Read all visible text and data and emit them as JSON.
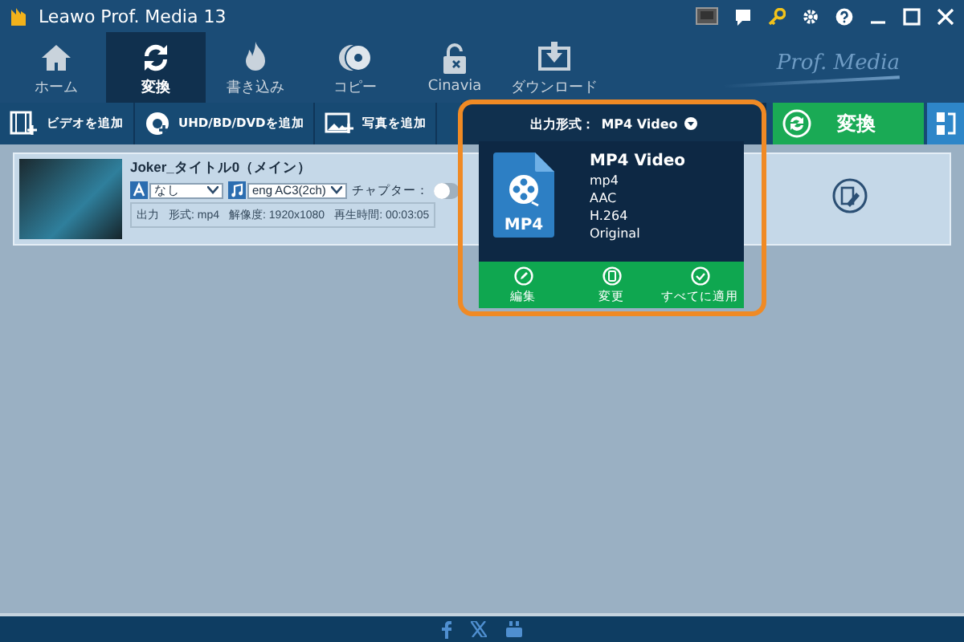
{
  "window": {
    "title": "Leawo Prof. Media 13"
  },
  "nav_tabs": [
    {
      "label": "ホーム",
      "selected": false
    },
    {
      "label": "変換",
      "selected": true
    },
    {
      "label": "書き込み",
      "selected": false
    },
    {
      "label": "コピー",
      "selected": false
    },
    {
      "label": "Cinavia",
      "selected": false
    },
    {
      "label": "ダウンロード",
      "selected": false
    }
  ],
  "brand": "Prof. Media",
  "toolbar": {
    "add_buttons": [
      "ビデオを追加",
      "UHD/BD/DVDを追加",
      "写真を追加"
    ],
    "output_format": {
      "label": "出力形式：",
      "value": "MP4 Video"
    },
    "convert": "変換"
  },
  "video": {
    "title": "Joker_タイトル0（メイン）",
    "subtitle": "なし",
    "audio": "eng AC3(2ch)",
    "chapter_label": "チャプター：",
    "chapter_on": false,
    "output_label": "出力",
    "details": [
      {
        "label": "形式:",
        "value": "mp4"
      },
      {
        "label": "解像度:",
        "value": "1920x1080"
      },
      {
        "label": "再生時間:",
        "value": "00:03:05"
      }
    ]
  },
  "format_popup": {
    "name": "MP4 Video",
    "badge": "MP4",
    "specs": [
      "mp4",
      "AAC",
      "H.264",
      "Original"
    ],
    "actions": [
      {
        "kind": "edit",
        "label": "編集"
      },
      {
        "kind": "change",
        "label": "変更"
      },
      {
        "kind": "apply_all",
        "label": "すべてに適用"
      }
    ]
  }
}
